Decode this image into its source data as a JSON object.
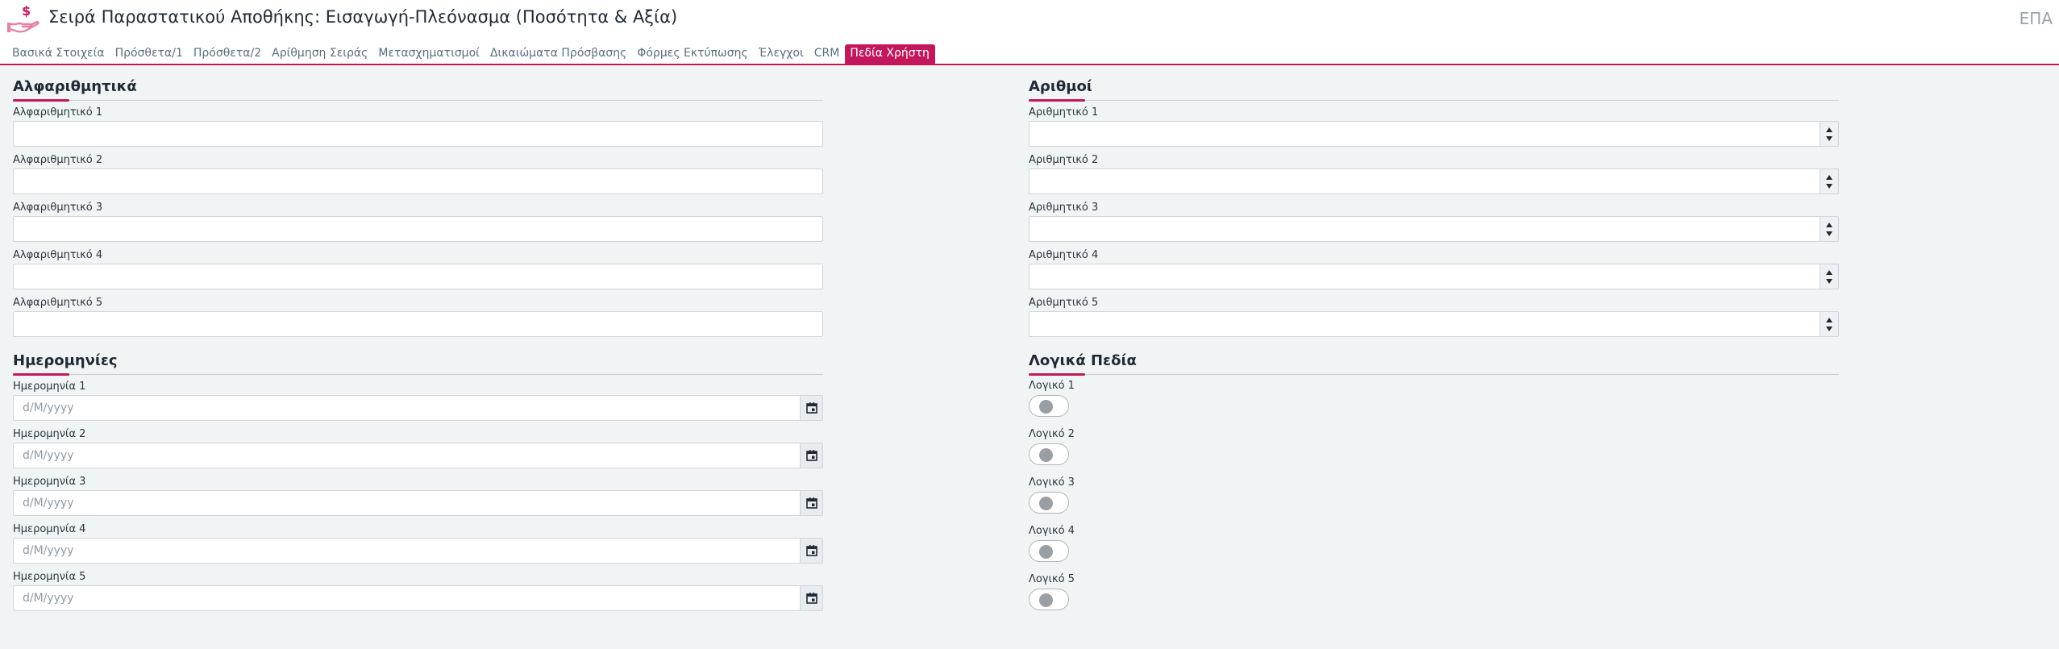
{
  "header": {
    "title": "Σειρά Παραστατικού Αποθήκης: Εισαγωγή-Πλεόνασμα (Ποσότητα & Αξία)",
    "code": "ΕΠΑ",
    "logo_icon": "hand-coin-icon",
    "accent_color": "#c2185b"
  },
  "tabs": [
    {
      "label": "Βασικά Στοιχεία",
      "active": false
    },
    {
      "label": "Πρόσθετα/1",
      "active": false
    },
    {
      "label": "Πρόσθετα/2",
      "active": false
    },
    {
      "label": "Αρίθμηση Σειράς",
      "active": false
    },
    {
      "label": "Μετασχηματισμοί",
      "active": false
    },
    {
      "label": "Δικαιώματα Πρόσβασης",
      "active": false
    },
    {
      "label": "Φόρμες Εκτύπωσης",
      "active": false
    },
    {
      "label": "Έλεγχοι",
      "active": false
    },
    {
      "label": "CRM",
      "active": false
    },
    {
      "label": "Πεδία Χρήστη",
      "active": true
    }
  ],
  "sections": {
    "alpha": {
      "title": "Αλφαριθμητικά",
      "fields": [
        {
          "label": "Αλφαριθμητικό 1",
          "value": ""
        },
        {
          "label": "Αλφαριθμητικό 2",
          "value": ""
        },
        {
          "label": "Αλφαριθμητικό 3",
          "value": ""
        },
        {
          "label": "Αλφαριθμητικό 4",
          "value": ""
        },
        {
          "label": "Αλφαριθμητικό 5",
          "value": ""
        }
      ]
    },
    "numbers": {
      "title": "Αριθμοί",
      "fields": [
        {
          "label": "Αριθμητικό 1",
          "value": ""
        },
        {
          "label": "Αριθμητικό 2",
          "value": ""
        },
        {
          "label": "Αριθμητικό 3",
          "value": ""
        },
        {
          "label": "Αριθμητικό 4",
          "value": ""
        },
        {
          "label": "Αριθμητικό 5",
          "value": ""
        }
      ]
    },
    "dates": {
      "title": "Ημερομηνίες",
      "placeholder": "d/M/yyyy",
      "fields": [
        {
          "label": "Ημερομηνία 1",
          "value": ""
        },
        {
          "label": "Ημερομηνία 2",
          "value": ""
        },
        {
          "label": "Ημερομηνία 3",
          "value": ""
        },
        {
          "label": "Ημερομηνία 4",
          "value": ""
        },
        {
          "label": "Ημερομηνία 5",
          "value": ""
        }
      ]
    },
    "booleans": {
      "title": "Λογικά Πεδία",
      "fields": [
        {
          "label": "Λογικό 1",
          "checked": false
        },
        {
          "label": "Λογικό 2",
          "checked": false
        },
        {
          "label": "Λογικό 3",
          "checked": false
        },
        {
          "label": "Λογικό 4",
          "checked": false
        },
        {
          "label": "Λογικό 5",
          "checked": false
        }
      ]
    }
  }
}
